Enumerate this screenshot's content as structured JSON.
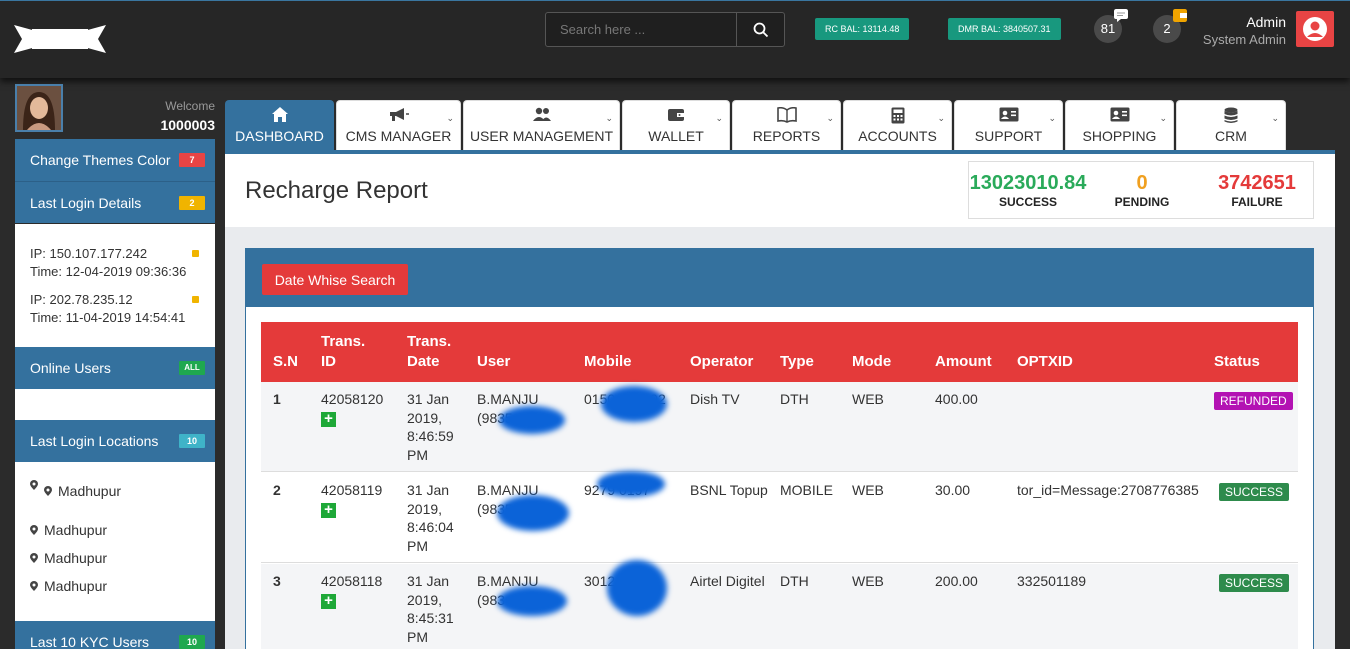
{
  "header": {
    "search_placeholder": "Search here ...",
    "rc_balance": "RC BAL: 13114.48",
    "dmr_balance": "DMR BAL: 3840507.31",
    "messages_count": "81",
    "wallet_count": "2",
    "admin_name": "Admin",
    "admin_role": "System Admin"
  },
  "sidebar": {
    "welcome_label": "Welcome",
    "welcome_id": "1000003",
    "change_themes": {
      "label": "Change Themes Color",
      "badge": "7"
    },
    "last_login": {
      "label": "Last Login Details",
      "badge": "2"
    },
    "logins": [
      {
        "ip": "IP: 150.107.177.242",
        "time": "Time: 12-04-2019 09:36:36"
      },
      {
        "ip": "IP: 202.78.235.12",
        "time": "Time: 11-04-2019 14:54:41"
      }
    ],
    "online_users": {
      "label": "Online Users",
      "badge": "ALL"
    },
    "last_locations": {
      "label": "Last Login Locations",
      "badge": "10"
    },
    "locations": [
      "Madhupur",
      "Madhupur",
      "Madhupur",
      "Madhupur"
    ],
    "kyc_users": {
      "label": "Last 10 KYC Users",
      "badge": "10"
    }
  },
  "tabs": [
    {
      "label": "DASHBOARD",
      "icon": "home-icon"
    },
    {
      "label": "CMS MANAGER",
      "icon": "megaphone-icon"
    },
    {
      "label": "USER MANAGEMENT",
      "icon": "users-icon"
    },
    {
      "label": "WALLET",
      "icon": "wallet-icon"
    },
    {
      "label": "REPORTS",
      "icon": "book-icon"
    },
    {
      "label": "ACCOUNTS",
      "icon": "calculator-icon"
    },
    {
      "label": "SUPPORT",
      "icon": "id-card-icon"
    },
    {
      "label": "SHOPPING",
      "icon": "id-card-icon"
    },
    {
      "label": "CRM",
      "icon": "database-icon"
    }
  ],
  "page": {
    "title": "Recharge Report",
    "stats": {
      "success": {
        "value": "13023010.84",
        "label": "SUCCESS"
      },
      "pending": {
        "value": "0",
        "label": "PENDING"
      },
      "failure": {
        "value": "3742651",
        "label": "FAILURE"
      }
    },
    "date_search_button": "Date Whise Search"
  },
  "table": {
    "headers": [
      "S.N",
      "Trans. ID",
      "Trans. Date",
      "User",
      "Mobile",
      "Operator",
      "Type",
      "Mode",
      "Amount",
      "OPTXID",
      "Status"
    ],
    "rows": [
      {
        "sn": "1",
        "trans_id": "42058120",
        "date": "31 Jan 2019, 8:46:59 PM",
        "user": "B.MANJU (9835",
        "mobile": "0150 158002",
        "operator": "Dish TV",
        "type": "DTH",
        "mode": "WEB",
        "amount": "400.00",
        "optxid": "",
        "status": "REFUNDED",
        "status_color": "#b312b3"
      },
      {
        "sn": "2",
        "trans_id": "42058119",
        "date": "31 Jan 2019, 8:46:04 PM",
        "user": "B.MANJU (9835",
        "mobile": "9279 0197",
        "operator": "BSNL Topup",
        "type": "MOBILE",
        "mode": "WEB",
        "amount": "30.00",
        "optxid": "tor_id=Message:2708776385",
        "status": "SUCCESS",
        "status_color": "#2e8b4c"
      },
      {
        "sn": "3",
        "trans_id": "42058118",
        "date": "31 Jan 2019, 8:45:31 PM",
        "user": "B.MANJU (983",
        "mobile": "3012",
        "operator": "Airtel Digitel",
        "type": "DTH",
        "mode": "WEB",
        "amount": "200.00",
        "optxid": "332501189",
        "status": "SUCCESS",
        "status_color": "#2e8b4c"
      }
    ]
  },
  "colors": {
    "primary": "#34719e",
    "success": "#2aaa5a",
    "pending": "#f0a020",
    "failure": "#e43a3a",
    "header_row": "#e43a3a"
  }
}
